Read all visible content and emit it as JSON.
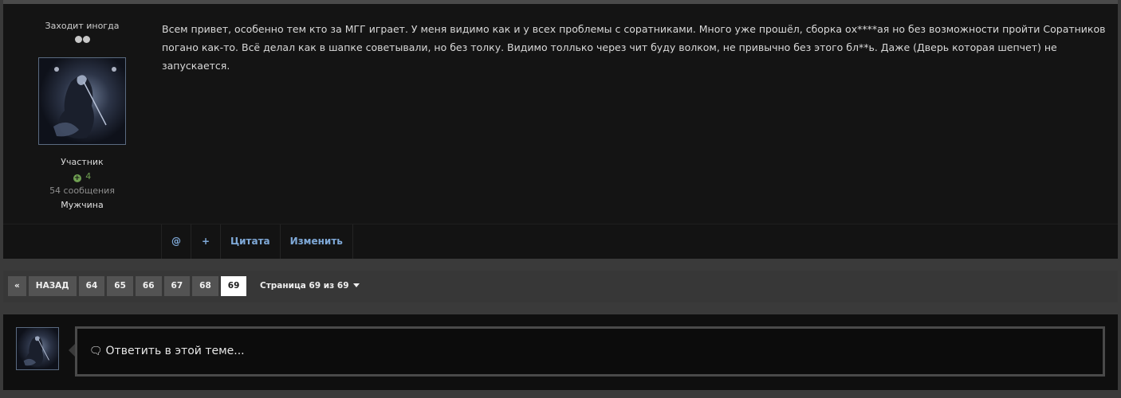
{
  "author": {
    "status": "Заходит иногда",
    "role": "Участник",
    "reputation": "4",
    "posts": "54 сообщения",
    "gender": "Мужчина"
  },
  "post": {
    "text_line1": "Всем привет, особенно тем кто за МГГ играет. У меня видимо как и у всех проблемы с соратниками. Много уже прошёл, сборка ох****ая но без возможности пройти Соратников",
    "text_line2": "погано как-то. Всё делал как в шапке советывали, но без толку. Видимо толлько через чит буду волком, не привычно без этого бл**ь. Даже (Дверь которая шепчет) не запускается."
  },
  "actions": {
    "mention_label": "@",
    "multiquote_label": "+",
    "quote_label": "Цитата",
    "edit_label": "Изменить"
  },
  "pagination": {
    "first_label": "«",
    "prev_label": "НАЗАД",
    "pages": [
      "64",
      "65",
      "66",
      "67",
      "68",
      "69"
    ],
    "active_page": "69",
    "jump_label": "Страница 69 из 69"
  },
  "reply": {
    "placeholder": "Ответить в этой теме..."
  },
  "colors": {
    "link": "#7fa9d8",
    "reputation": "#6f9f52",
    "background": "#141414"
  }
}
